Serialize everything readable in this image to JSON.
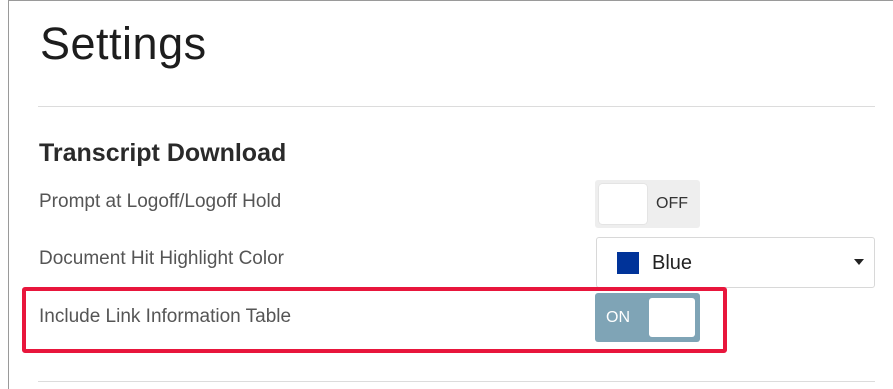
{
  "page": {
    "title": "Settings"
  },
  "section": {
    "heading": "Transcript Download"
  },
  "settings": [
    {
      "label": "Prompt at Logoff/Logoff Hold",
      "control": "toggle",
      "state": "OFF"
    },
    {
      "label": "Document Hit Highlight Color",
      "control": "select",
      "selected": "Blue",
      "swatch_color": "#003399"
    },
    {
      "label": "Include Link Information Table",
      "control": "toggle",
      "state": "ON"
    }
  ],
  "colors": {
    "toggle_on_bg": "#7fa4b6",
    "toggle_off_bg": "#eeeeee",
    "highlight_border": "#e8163c"
  }
}
